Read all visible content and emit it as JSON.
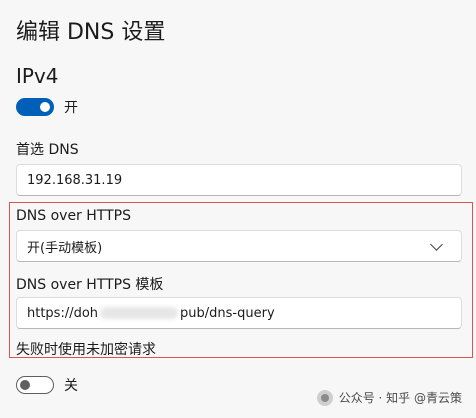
{
  "dialog": {
    "title": "编辑 DNS 设置",
    "section": "IPv4",
    "ipv4_toggle_state": "开",
    "preferred_dns_label": "首选 DNS",
    "preferred_dns_value": "192.168.31.19",
    "doh_label": "DNS over HTTPS",
    "doh_value": "开(手动模板)",
    "doh_template_label": "DNS over HTTPS 模板",
    "doh_template_prefix": "https://doh",
    "doh_template_suffix": "pub/dns-query",
    "fallback_label": "失败时使用未加密请求",
    "fallback_toggle_state": "关"
  },
  "watermark": {
    "text": "公众号 · 知乎 @青云策"
  },
  "colors": {
    "accent": "#005fb8",
    "highlight_border": "#d9534f"
  }
}
